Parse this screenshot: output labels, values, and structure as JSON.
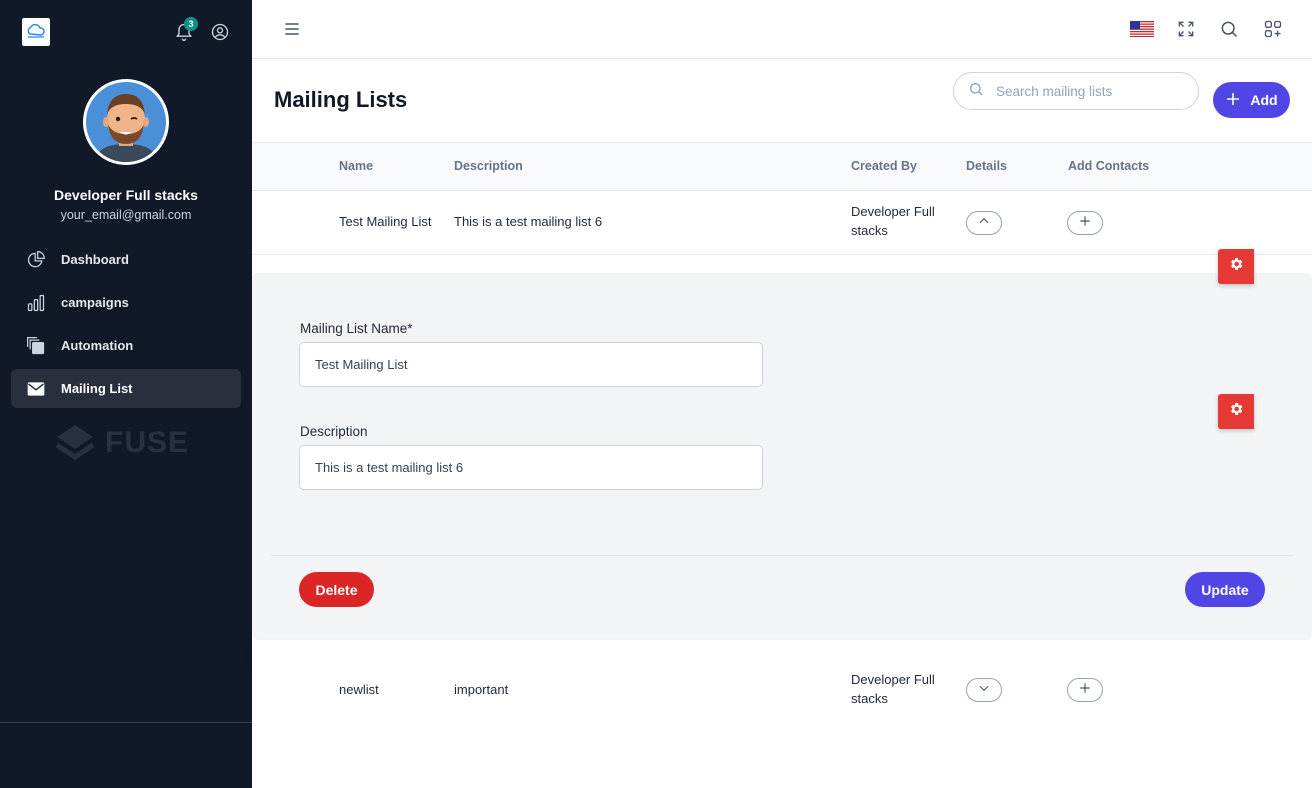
{
  "sidebar": {
    "notification_count": "3",
    "user_name": "Developer Full stacks",
    "user_email": "your_email@gmail.com",
    "items": [
      {
        "label": "Dashboard",
        "icon": "pie-chart-icon"
      },
      {
        "label": "campaigns",
        "icon": "bar-chart-icon"
      },
      {
        "label": "Automation",
        "icon": "copy-icon"
      },
      {
        "label": "Mailing List",
        "icon": "mail-icon",
        "active": true
      }
    ],
    "watermark": "FUSE"
  },
  "header": {
    "title": "Mailing Lists",
    "search_placeholder": "Search mailing lists",
    "add_label": "Add"
  },
  "table": {
    "columns": [
      "Name",
      "Description",
      "Created By",
      "Details",
      "Add Contacts"
    ],
    "rows": [
      {
        "name": "Test Mailing List",
        "description": "This is a test mailing list 6",
        "created_by_1": "Developer Full",
        "created_by_2": "stacks",
        "expanded": true
      },
      {
        "name": "newlist",
        "description": "important",
        "created_by_1": "Developer Full",
        "created_by_2": "stacks",
        "expanded": false
      }
    ]
  },
  "details": {
    "name_label": "Mailing List Name*",
    "name_value": "Test Mailing List",
    "description_label": "Description",
    "description_value": "This is a test mailing list 6",
    "delete_label": "Delete",
    "update_label": "Update"
  },
  "colors": {
    "sidebar_bg": "#111827",
    "accent": "#4f46e5",
    "danger": "#dc2626",
    "badge": "#0d9488"
  }
}
